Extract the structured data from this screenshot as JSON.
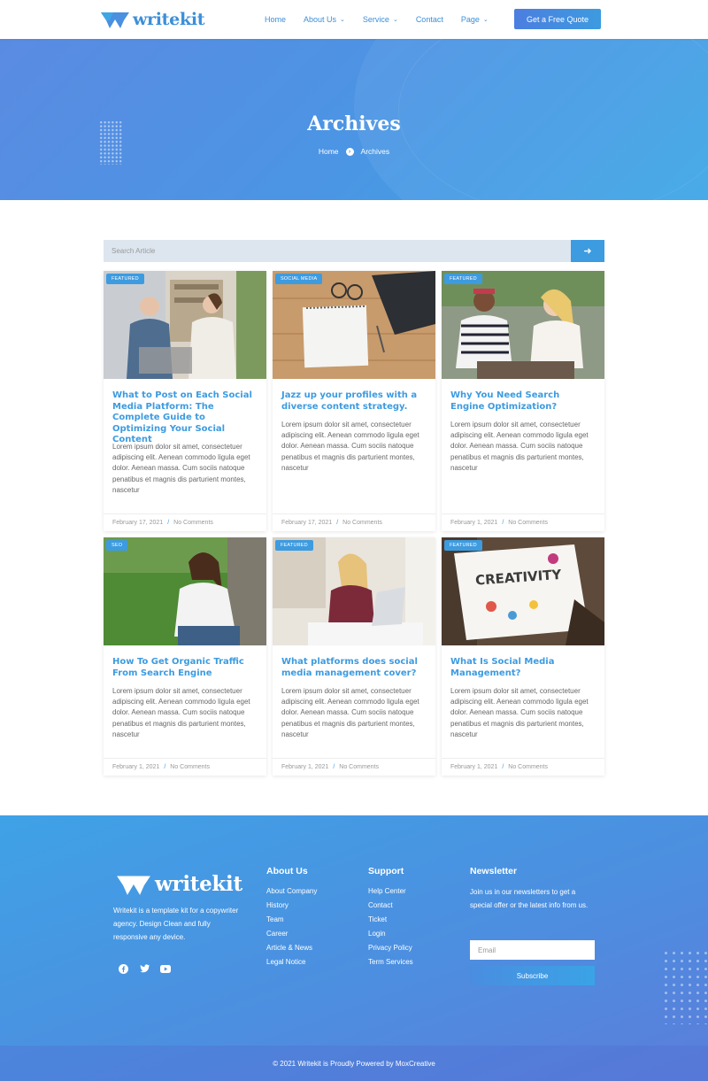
{
  "brand": {
    "name": "writekit",
    "accent": "#3d9be0"
  },
  "nav": {
    "items": [
      {
        "label": "Home",
        "dropdown": false
      },
      {
        "label": "About Us",
        "dropdown": true
      },
      {
        "label": "Service",
        "dropdown": true
      },
      {
        "label": "Contact",
        "dropdown": false
      },
      {
        "label": "Page",
        "dropdown": true
      }
    ],
    "cta": "Get a Free Quote"
  },
  "hero": {
    "title": "Archives",
    "breadcrumb": [
      "Home",
      "Archives"
    ]
  },
  "search": {
    "placeholder": "Search Article",
    "icon": "arrow-right-icon"
  },
  "posts": [
    {
      "badge": "FEATURED",
      "title": "What to Post on Each Social Media Platform: The Complete Guide to Optimizing Your Social Content",
      "excerpt": "Lorem ipsum dolor sit amet, consectetuer adipiscing elit. Aenean commodo ligula eget dolor. Aenean massa. Cum sociis natoque penatibus et magnis dis parturient montes, nascetur",
      "date": "February 17, 2021",
      "comments": "No Comments"
    },
    {
      "badge": "SOCIAL MEDIA",
      "title": "Jazz up your profiles with a diverse content strategy.",
      "excerpt": "Lorem ipsum dolor sit amet, consectetuer adipiscing elit. Aenean commodo ligula eget dolor. Aenean massa. Cum sociis natoque penatibus et magnis dis parturient montes, nascetur",
      "date": "February 17, 2021",
      "comments": "No Comments"
    },
    {
      "badge": "FEATURED",
      "title": "Why You Need Search Engine Optimization?",
      "excerpt": "Lorem ipsum dolor sit amet, consectetuer adipiscing elit. Aenean commodo ligula eget dolor. Aenean massa. Cum sociis natoque penatibus et magnis dis parturient montes, nascetur",
      "date": "February 1, 2021",
      "comments": "No Comments"
    },
    {
      "badge": "SEO",
      "title": "How To Get Organic Traffic From Search Engine",
      "excerpt": "Lorem ipsum dolor sit amet, consectetuer adipiscing elit. Aenean commodo ligula eget dolor. Aenean massa. Cum sociis natoque penatibus et magnis dis parturient montes, nascetur",
      "date": "February 1, 2021",
      "comments": "No Comments"
    },
    {
      "badge": "FEATURED",
      "title": "What platforms does social media management cover?",
      "excerpt": "Lorem ipsum dolor sit amet, consectetuer adipiscing elit. Aenean commodo ligula eget dolor. Aenean massa. Cum sociis natoque penatibus et magnis dis parturient montes, nascetur",
      "date": "February 1, 2021",
      "comments": "No Comments"
    },
    {
      "badge": "FEATURED",
      "title": "What Is Social Media Management?",
      "excerpt": "Lorem ipsum dolor sit amet, consectetuer adipiscing elit. Aenean commodo ligula eget dolor. Aenean massa. Cum sociis natoque penatibus et magnis dis parturient montes, nascetur",
      "date": "February 1, 2021",
      "comments": "No Comments"
    }
  ],
  "footer": {
    "description": "Writekit is a template kit for a copywriter agency. Design Clean and fully responsive any device.",
    "socials": [
      "facebook-icon",
      "twitter-icon",
      "youtube-icon"
    ],
    "about": {
      "title": "About Us",
      "links": [
        "About Company",
        "History",
        "Team",
        "Career",
        "Article & News",
        "Legal Notice"
      ]
    },
    "support": {
      "title": "Support",
      "links": [
        "Help Center",
        "Contact",
        "Ticket",
        "Login",
        "Privacy Policy",
        "Term Services"
      ]
    },
    "newsletter": {
      "title": "Newsletter",
      "text": "Join us in our newsletters to get a special offer or the latest info from us.",
      "email_placeholder": "Email",
      "button": "Subscribe"
    },
    "copyright": "© 2021 Writekit is Proudly Powered by MoxCreative"
  }
}
